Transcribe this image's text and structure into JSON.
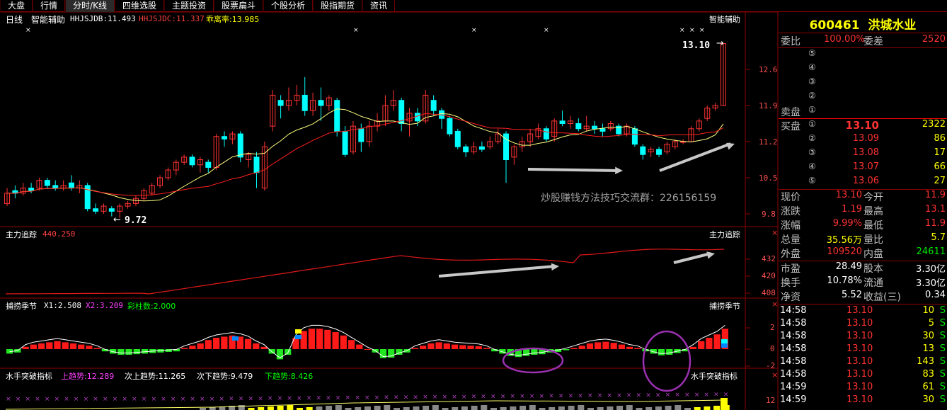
{
  "tabs": [
    "大盘",
    "行情",
    "分时/K线",
    "四维选股",
    "主题投资",
    "股票扁斗",
    "个股分析",
    "股指期货",
    "资讯"
  ],
  "active_tab": 2,
  "panel1": {
    "period_label": "日线",
    "indicator": "智能辅助",
    "line1": "HHJSJDB:11.493",
    "line2": "HHJSJDC:11.337",
    "line3": "乖离率:13.985",
    "right_name": "智能辅助",
    "price_axis": [
      "12.6",
      "11.9",
      "11.2",
      "10.5",
      "9.8"
    ],
    "high_mark": "13.10",
    "low_mark": "9.72",
    "watermark": "炒股赚钱方法技巧交流群：226156159"
  },
  "panel2": {
    "name": "主力追踪",
    "value": "440.250",
    "right_name": "主力追踪",
    "axis": [
      "432",
      "420",
      "408"
    ]
  },
  "panel3": {
    "name": "捕捞季节",
    "x1": "X1:2.508",
    "x2": "X2:3.209",
    "cz": "彩柱数:2.000",
    "right_name": "捕捞季节",
    "axis": [
      "2",
      "0",
      "-2"
    ]
  },
  "panel4": {
    "name": "水手突破指标",
    "up": "上趋势:12.289",
    "sub_up": "次上趋势:11.265",
    "sub_down": "次下趋势:9.479",
    "down": "下趋势:8.426",
    "right_name": "水手突破指标",
    "axis": [
      "12"
    ]
  },
  "quote": {
    "code": "600461",
    "name": "洪城水业",
    "weibi_label": "委比",
    "weibi": "100.00%",
    "weicha_label": "委差",
    "weicha": "2520",
    "sell_label": "卖盘",
    "buy_label": "买盘",
    "sell_levels": [
      "⑤",
      "④",
      "③",
      "②",
      "①"
    ],
    "buy_levels": [
      {
        "n": "①",
        "price": "13.10",
        "vol": "2322"
      },
      {
        "n": "②",
        "price": "13.09",
        "vol": "86"
      },
      {
        "n": "③",
        "price": "13.08",
        "vol": "17"
      },
      {
        "n": "④",
        "price": "13.07",
        "vol": "66"
      },
      {
        "n": "⑤",
        "price": "13.06",
        "vol": "27"
      }
    ],
    "stats": [
      {
        "l1": "现价",
        "v1": "13.10",
        "l2": "今开",
        "v2": "11.9"
      },
      {
        "l1": "涨跌",
        "v1": "1.19",
        "l2": "最高",
        "v2": "13.1"
      },
      {
        "l1": "涨幅",
        "v1": "9.99%",
        "l2": "最低",
        "v2": "11.9"
      },
      {
        "l1": "总量",
        "v1": "35.56万",
        "l2": "量比",
        "v2": "5.7"
      },
      {
        "l1": "外盘",
        "v1": "109520",
        "l2": "内盘",
        "v2": "24611"
      }
    ],
    "fundamentals": [
      {
        "l1": "市盈",
        "v1": "28.49",
        "l2": "股本",
        "v2": "3.30亿"
      },
      {
        "l1": "换手",
        "v1": "10.78%",
        "l2": "流通",
        "v2": "3.30亿"
      },
      {
        "l1": "净资",
        "v1": "5.52",
        "l2": "收益(三)",
        "v2": "0.34"
      }
    ],
    "ticks": [
      {
        "t": "14:58",
        "p": "13.10",
        "v": "10",
        "f": "S"
      },
      {
        "t": "14:58",
        "p": "13.10",
        "v": "5",
        "f": "S"
      },
      {
        "t": "14:58",
        "p": "13.10",
        "v": "30",
        "f": "S"
      },
      {
        "t": "14:58",
        "p": "13.10",
        "v": "13",
        "f": "S"
      },
      {
        "t": "14:58",
        "p": "13.10",
        "v": "143",
        "f": "S"
      },
      {
        "t": "14:58",
        "p": "13.10",
        "v": "83",
        "f": "S"
      },
      {
        "t": "14:59",
        "p": "13.10",
        "v": "61",
        "f": "S"
      },
      {
        "t": "14:59",
        "p": "13.10",
        "v": "30",
        "f": "S"
      }
    ]
  },
  "colors": {
    "up": "#ff3232",
    "down": "#00ffff",
    "grid": "#8b0000",
    "ma_yellow": "#ffff80",
    "ma_red": "#ff2020"
  }
}
